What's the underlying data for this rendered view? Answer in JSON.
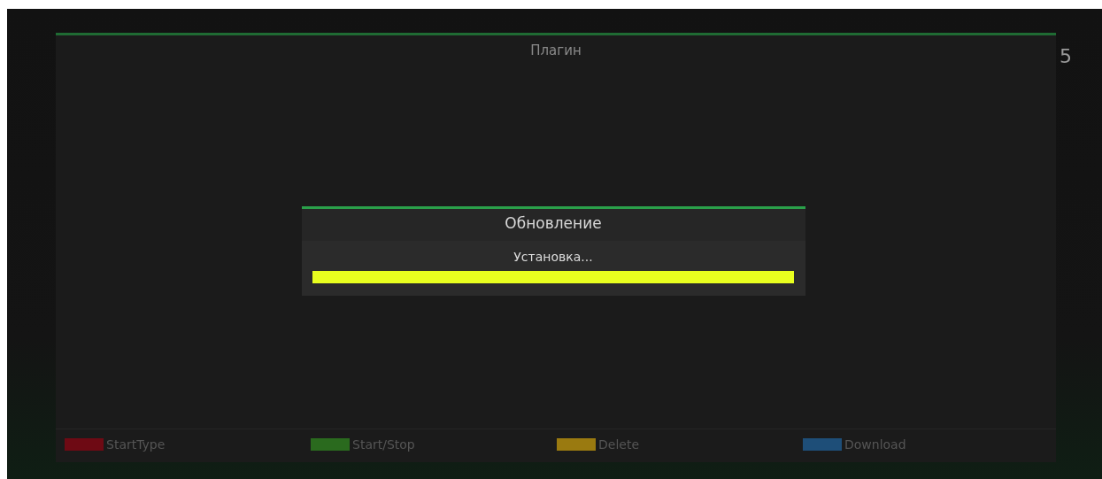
{
  "screen": {
    "title": "Плагин",
    "edge_text": "5"
  },
  "dialog": {
    "title": "Обновление",
    "message": "Установка...",
    "progress": {
      "level": 1
    }
  },
  "color_keys": [
    {
      "label": "StartType",
      "color": "#6e0a14"
    },
    {
      "label": "Start/Stop",
      "color": "#2a6a1e"
    },
    {
      "label": "Delete",
      "color": "#9a7a10"
    },
    {
      "label": "Download",
      "color": "#1e4e78"
    }
  ]
}
